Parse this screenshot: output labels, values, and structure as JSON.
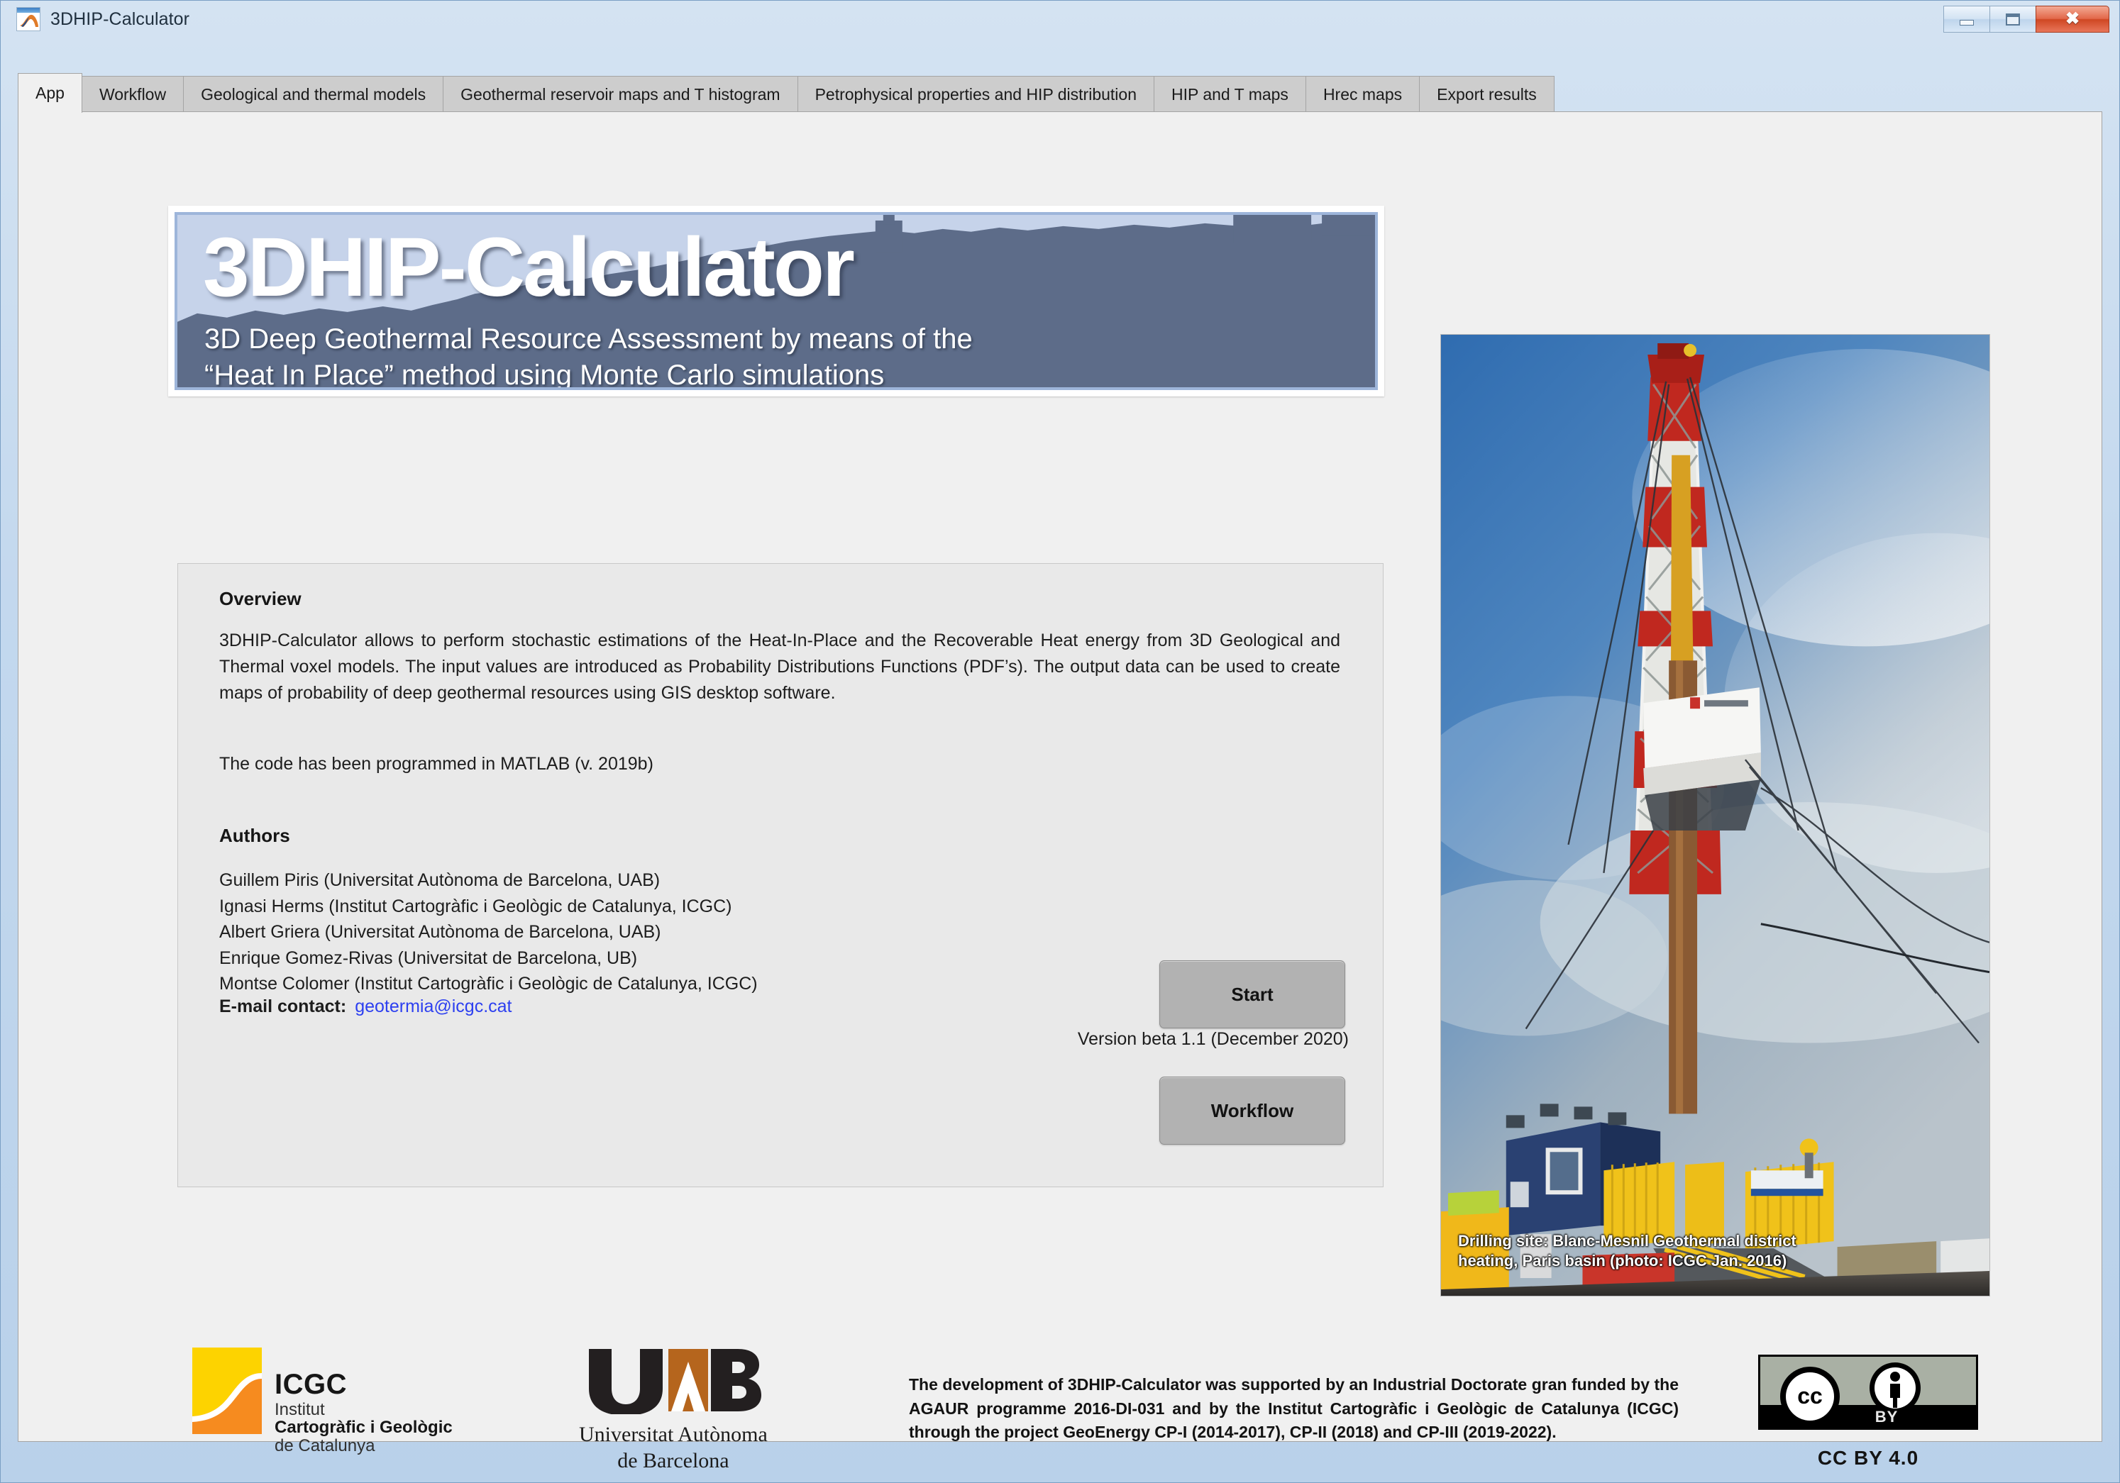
{
  "window": {
    "title": "3DHIP-Calculator",
    "icon": "matlab-app-icon",
    "controls": {
      "minimize": "minimize-button",
      "maximize": "maximize-button",
      "close": "close-button",
      "close_glyph": "✖"
    }
  },
  "tabs": [
    {
      "label": "App",
      "active": true
    },
    {
      "label": "Workflow",
      "active": false
    },
    {
      "label": "Geological and thermal models",
      "active": false
    },
    {
      "label": "Geothermal reservoir maps and T histogram",
      "active": false
    },
    {
      "label": "Petrophysical properties and HIP distribution",
      "active": false
    },
    {
      "label": "HIP and T maps",
      "active": false
    },
    {
      "label": "Hrec maps",
      "active": false
    },
    {
      "label": "Export results",
      "active": false
    }
  ],
  "banner": {
    "title": "3DHIP-Calculator",
    "subtitle_line1": "3D Deep Geothermal Resource Assessment by means of the",
    "subtitle_line2": "“Heat In Place” method using Monte Carlo simulations",
    "bg_sky": "#c6d3ea",
    "bg_ground": "#5d6c89"
  },
  "overview": {
    "heading": "Overview",
    "body": "3DHIP-Calculator allows to perform stochastic estimations of the Heat-In-Place and the Recoverable Heat energy from 3D Geological and Thermal voxel models. The input values are introduced as Probability Distributions Functions (PDF’s). The output data can be used to create maps of probability of deep geothermal resources using GIS desktop software.",
    "matlab_note": "The code has been programmed in MATLAB (v. 2019b)"
  },
  "authors": {
    "heading": "Authors",
    "list": [
      "Guillem Piris (Universitat Autònoma de Barcelona, UAB)",
      "Ignasi Herms (Institut Cartogràfic i Geològic de Catalunya, ICGC)",
      "Albert Griera (Universitat Autònoma de Barcelona, UAB)",
      "Enrique Gomez-Rivas (Universitat de Barcelona, UB)",
      "Montse Colomer (Institut Cartogràfic i Geològic de Catalunya, ICGC)"
    ]
  },
  "contact": {
    "label": "E-mail contact:",
    "email": "geotermia@icgc.cat",
    "email_color": "#2c3ff0"
  },
  "version": "Version beta 1.1 (December 2020)",
  "buttons": {
    "start": "Start",
    "workflow": "Workflow"
  },
  "photo": {
    "caption_line1": "Drilling site: Blanc-Mesnil Geothermal district",
    "caption_line2": "heating, Paris basin (photo: ICGC Jan. 2016)"
  },
  "footer": {
    "icgc": {
      "acronym": "ICGC",
      "line1": "Institut",
      "line2": "Cartogràfic i Geològic",
      "line3": "de Catalunya",
      "color_yellow": "#fdd300",
      "color_orange": "#f68b1f"
    },
    "uab": {
      "mark": "UAB",
      "line1": "Universitat Autònoma",
      "line2": "de Barcelona",
      "color_orange": "#b5651d"
    },
    "acknowledgement": "The development of 3DHIP-Calculator was supported by an Industrial Doctorate gran funded by the AGAUR programme 2016-DI-031 and by the Institut Cartogràfic i Geològic de Catalunya (ICGC) through the project GeoEnergy CP-I (2014-2017), CP-II (2018) and CP-III (2019-2022).",
    "license": {
      "badge_cc": "cc",
      "badge_by": "BY",
      "label": "CC BY 4.0"
    }
  }
}
